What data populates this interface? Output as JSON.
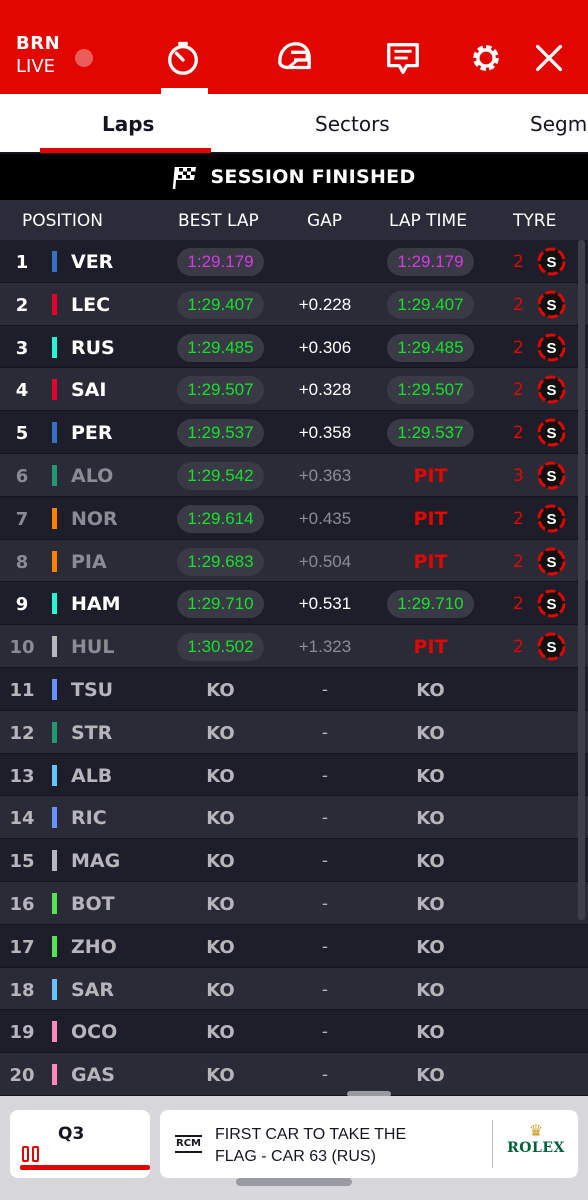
{
  "header": {
    "location": "BRN",
    "live_label": "LIVE",
    "accent_color": "#e10600"
  },
  "icons": [
    "timer-icon",
    "helmet-icon",
    "race-control-messages-icon",
    "settings-gear-icon",
    "close-icon"
  ],
  "tabs": [
    {
      "label": "Laps",
      "active": true
    },
    {
      "label": "Sectors",
      "active": false
    },
    {
      "label": "Segm",
      "active": false
    }
  ],
  "banner": {
    "text": "SESSION FINISHED"
  },
  "columns": {
    "position": "POSITION",
    "best_lap": "BEST LAP",
    "gap": "GAP",
    "lap_time": "LAP TIME",
    "tyre": "TYRE"
  },
  "rows": [
    {
      "pos": "1",
      "code": "VER",
      "team_color": "#3671c6",
      "best": "1:29.179",
      "best_color": "purple",
      "gap": "",
      "lap": "1:29.179",
      "lap_color": "purple",
      "tyre_laps": "2",
      "tyre": "S",
      "status": "normal"
    },
    {
      "pos": "2",
      "code": "LEC",
      "team_color": "#e8002d",
      "best": "1:29.407",
      "best_color": "green",
      "gap": "+0.228",
      "lap": "1:29.407",
      "lap_color": "green",
      "tyre_laps": "2",
      "tyre": "S",
      "status": "normal"
    },
    {
      "pos": "3",
      "code": "RUS",
      "team_color": "#27f4d2",
      "best": "1:29.485",
      "best_color": "green",
      "gap": "+0.306",
      "lap": "1:29.485",
      "lap_color": "green",
      "tyre_laps": "2",
      "tyre": "S",
      "status": "normal"
    },
    {
      "pos": "4",
      "code": "SAI",
      "team_color": "#e8002d",
      "best": "1:29.507",
      "best_color": "green",
      "gap": "+0.328",
      "lap": "1:29.507",
      "lap_color": "green",
      "tyre_laps": "2",
      "tyre": "S",
      "status": "normal"
    },
    {
      "pos": "5",
      "code": "PER",
      "team_color": "#3671c6",
      "best": "1:29.537",
      "best_color": "green",
      "gap": "+0.358",
      "lap": "1:29.537",
      "lap_color": "green",
      "tyre_laps": "2",
      "tyre": "S",
      "status": "normal"
    },
    {
      "pos": "6",
      "code": "ALO",
      "team_color": "#229971",
      "best": "1:29.542",
      "best_color": "green",
      "gap": "+0.363",
      "lap": "PIT",
      "lap_color": "pit",
      "tyre_laps": "3",
      "tyre": "S",
      "status": "out"
    },
    {
      "pos": "7",
      "code": "NOR",
      "team_color": "#ff8000",
      "best": "1:29.614",
      "best_color": "green",
      "gap": "+0.435",
      "lap": "PIT",
      "lap_color": "pit",
      "tyre_laps": "2",
      "tyre": "S",
      "status": "out"
    },
    {
      "pos": "8",
      "code": "PIA",
      "team_color": "#ff8000",
      "best": "1:29.683",
      "best_color": "green",
      "gap": "+0.504",
      "lap": "PIT",
      "lap_color": "pit",
      "tyre_laps": "2",
      "tyre": "S",
      "status": "out"
    },
    {
      "pos": "9",
      "code": "HAM",
      "team_color": "#27f4d2",
      "best": "1:29.710",
      "best_color": "green",
      "gap": "+0.531",
      "lap": "1:29.710",
      "lap_color": "green",
      "tyre_laps": "2",
      "tyre": "S",
      "status": "normal"
    },
    {
      "pos": "10",
      "code": "HUL",
      "team_color": "#b6babd",
      "best": "1:30.502",
      "best_color": "green",
      "gap": "+1.323",
      "lap": "PIT",
      "lap_color": "pit",
      "tyre_laps": "2",
      "tyre": "S",
      "status": "out"
    },
    {
      "pos": "11",
      "code": "TSU",
      "team_color": "#6692ff",
      "best": "KO",
      "gap": "-",
      "lap": "KO",
      "status": "ko"
    },
    {
      "pos": "12",
      "code": "STR",
      "team_color": "#229971",
      "best": "KO",
      "gap": "-",
      "lap": "KO",
      "status": "ko"
    },
    {
      "pos": "13",
      "code": "ALB",
      "team_color": "#64c4ff",
      "best": "KO",
      "gap": "-",
      "lap": "KO",
      "status": "ko"
    },
    {
      "pos": "14",
      "code": "RIC",
      "team_color": "#6692ff",
      "best": "KO",
      "gap": "-",
      "lap": "KO",
      "status": "ko"
    },
    {
      "pos": "15",
      "code": "MAG",
      "team_color": "#b6babd",
      "best": "KO",
      "gap": "-",
      "lap": "KO",
      "status": "ko"
    },
    {
      "pos": "16",
      "code": "BOT",
      "team_color": "#52e252",
      "best": "KO",
      "gap": "-",
      "lap": "KO",
      "status": "ko"
    },
    {
      "pos": "17",
      "code": "ZHO",
      "team_color": "#52e252",
      "best": "KO",
      "gap": "-",
      "lap": "KO",
      "status": "ko"
    },
    {
      "pos": "18",
      "code": "SAR",
      "team_color": "#64c4ff",
      "best": "KO",
      "gap": "-",
      "lap": "KO",
      "status": "ko"
    },
    {
      "pos": "19",
      "code": "OCO",
      "team_color": "#ff87bc",
      "best": "KO",
      "gap": "-",
      "lap": "KO",
      "status": "ko"
    },
    {
      "pos": "20",
      "code": "GAS",
      "team_color": "#ff87bc",
      "best": "KO",
      "gap": "-",
      "lap": "KO",
      "status": "ko"
    }
  ],
  "session_card": {
    "label": "Q3"
  },
  "rcm": {
    "badge": "RCM",
    "message": "FIRST CAR TO TAKE THE FLAG - CAR 63 (RUS)",
    "sponsor": "ROLEX"
  }
}
